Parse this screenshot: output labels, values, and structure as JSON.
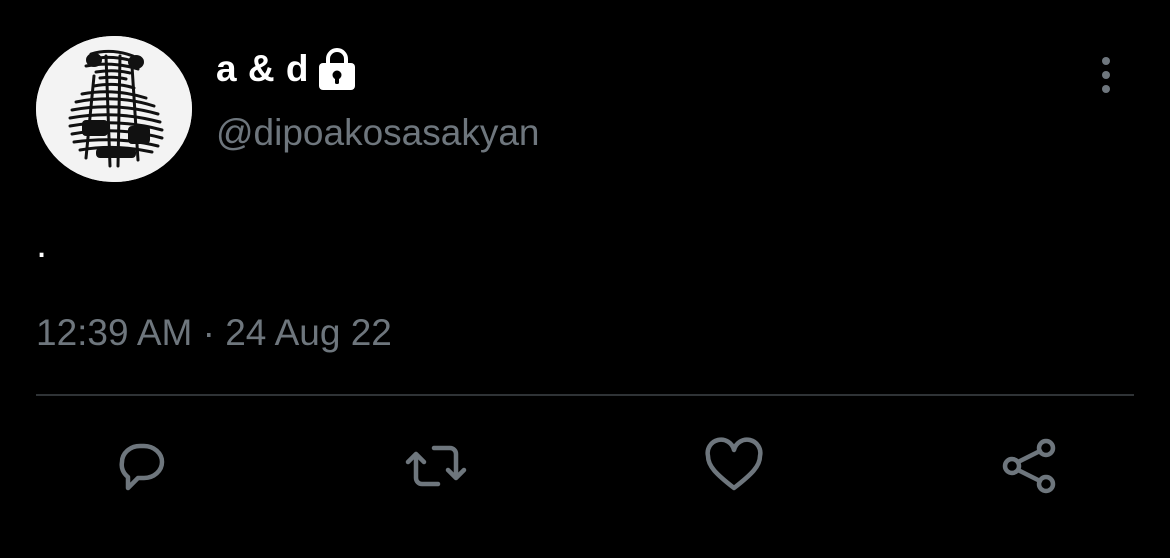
{
  "user": {
    "display_name": "a & d",
    "handle": "@dipoakosasakyan",
    "lock_icon": "lock-icon",
    "avatar_icon": "avatar"
  },
  "tweet": {
    "text": ".",
    "timestamp": "12:39 AM · 24 Aug 22"
  },
  "actions": {
    "reply_icon": "reply-icon",
    "retweet_icon": "retweet-icon",
    "like_icon": "heart-icon",
    "share_icon": "share-icon",
    "more_icon": "more-vertical-icon"
  },
  "colors": {
    "background": "#000000",
    "text_primary": "#ffffff",
    "text_secondary": "#6e767d",
    "divider": "#2f3336"
  }
}
